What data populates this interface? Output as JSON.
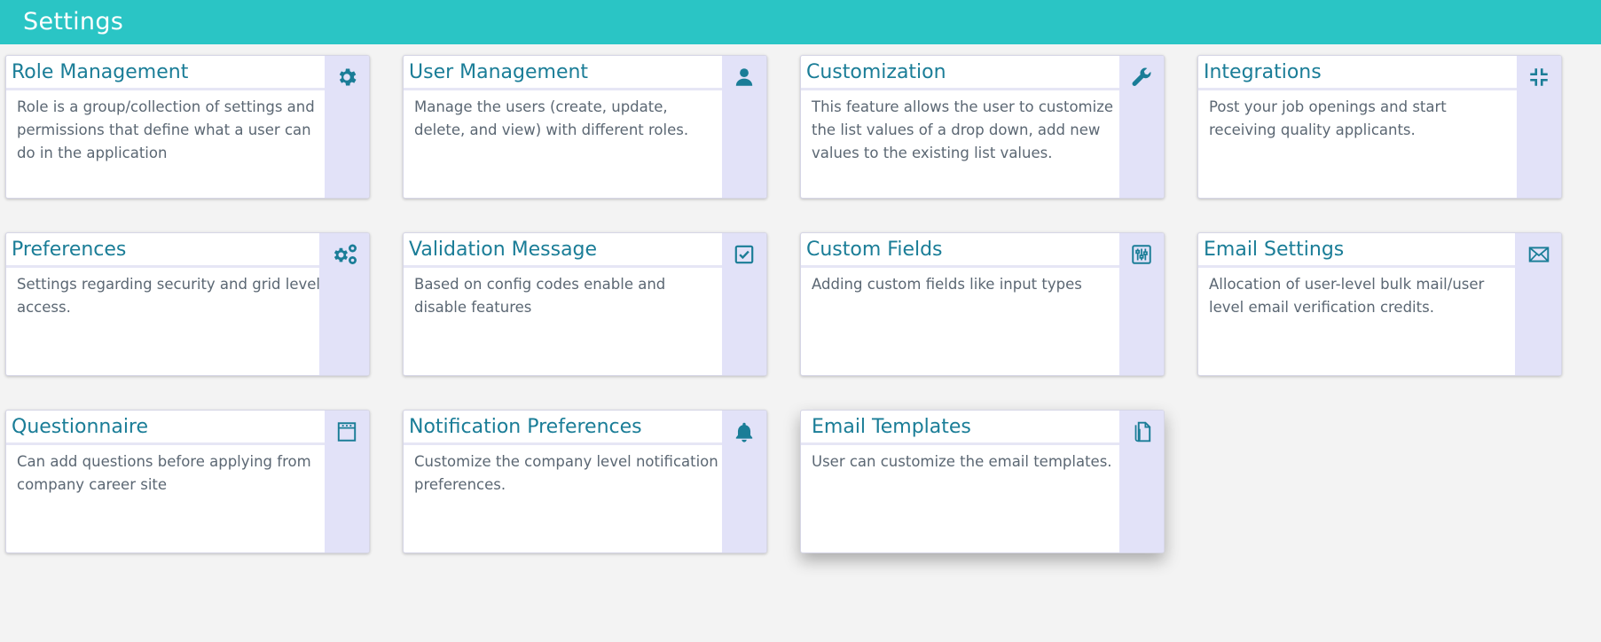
{
  "header": {
    "title": "Settings"
  },
  "cards": [
    {
      "title": "Role Management",
      "desc": "Role is a group/collection of settings and permissions that define what a user can do in the application",
      "icon": "gear-icon"
    },
    {
      "title": "User Management",
      "desc": "Manage the users (create, update, delete, and view) with different roles.",
      "icon": "user-icon"
    },
    {
      "title": "Customization",
      "desc": "This feature allows the user to customize the list values of a drop down, add new values to the existing list values.",
      "icon": "wrench-icon"
    },
    {
      "title": "Integrations",
      "desc": "Post your job openings and start receiving quality applicants.",
      "icon": "compress-icon"
    },
    {
      "title": "Preferences",
      "desc": "Settings regarding security and grid level access.",
      "icon": "gears-icon"
    },
    {
      "title": "Validation Message",
      "desc": "Based on config codes enable and disable features",
      "icon": "check-square-icon"
    },
    {
      "title": "Custom Fields",
      "desc": "Adding custom fields like input types",
      "icon": "sliders-icon"
    },
    {
      "title": "Email Settings",
      "desc": "Allocation of user-level bulk mail/user level email verification credits.",
      "icon": "envelope-icon"
    },
    {
      "title": "Questionnaire",
      "desc": "Can add questions before applying from company career site",
      "icon": "notepad-icon"
    },
    {
      "title": "Notification Preferences",
      "desc": "Customize the company level notification preferences.",
      "icon": "bell-icon"
    },
    {
      "title": "Email Templates",
      "desc": "User can customize the email templates.",
      "icon": "document-icon"
    }
  ],
  "colors": {
    "header_bg": "#2ac5c5",
    "accent": "#1a7d97",
    "side_bg": "#e2e2f8"
  }
}
